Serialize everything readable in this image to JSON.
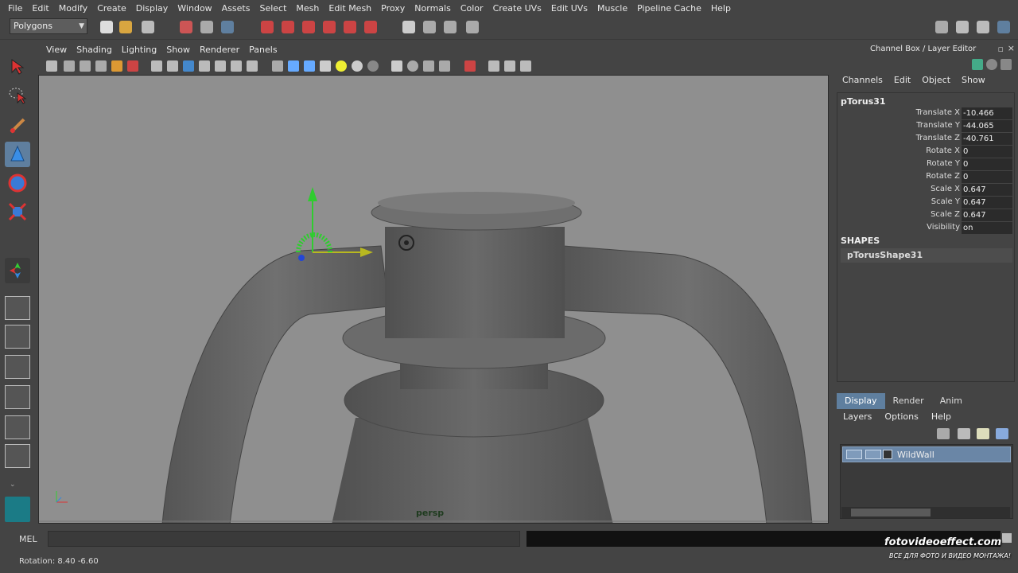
{
  "menubar": [
    "File",
    "Edit",
    "Modify",
    "Create",
    "Display",
    "Window",
    "Assets",
    "Select",
    "Mesh",
    "Edit Mesh",
    "Proxy",
    "Normals",
    "Color",
    "Create UVs",
    "Edit UVs",
    "Muscle",
    "Pipeline Cache",
    "Help"
  ],
  "statusline": {
    "mode": "Polygons"
  },
  "panel": {
    "menu": [
      "View",
      "Shading",
      "Lighting",
      "Show",
      "Renderer",
      "Panels"
    ],
    "camera_label": "persp"
  },
  "channel_box": {
    "title": "Channel Box / Layer Editor",
    "menu": [
      "Channels",
      "Edit",
      "Object",
      "Show"
    ],
    "object_name": "pTorus31",
    "attributes": [
      {
        "label": "Translate X",
        "value": "-10.466"
      },
      {
        "label": "Translate Y",
        "value": "-44.065"
      },
      {
        "label": "Translate Z",
        "value": "-40.761"
      },
      {
        "label": "Rotate X",
        "value": "0"
      },
      {
        "label": "Rotate Y",
        "value": "0"
      },
      {
        "label": "Rotate Z",
        "value": "0"
      },
      {
        "label": "Scale X",
        "value": "0.647"
      },
      {
        "label": "Scale Y",
        "value": "0.647"
      },
      {
        "label": "Scale Z",
        "value": "0.647"
      },
      {
        "label": "Visibility",
        "value": "on"
      }
    ],
    "shapes_heading": "SHAPES",
    "shape_name": "pTorusShape31"
  },
  "layer_editor": {
    "tabs": [
      "Display",
      "Render",
      "Anim"
    ],
    "active_tab": "Display",
    "menu": [
      "Layers",
      "Options",
      "Help"
    ],
    "layers": [
      {
        "name": "WildWall"
      }
    ]
  },
  "command_line": {
    "label": "MEL"
  },
  "help_line": {
    "text": "Rotation:   8.40     -6.60"
  },
  "watermark": {
    "text": "fotovideoeffect.com",
    "subtext": "ВСЕ ДЛЯ ФОТО И ВИДЕО МОНТАЖА!"
  },
  "colors": {
    "accent": "#5f7f9f",
    "viewport_bg": "#8f8f8f",
    "background": "#444444"
  }
}
